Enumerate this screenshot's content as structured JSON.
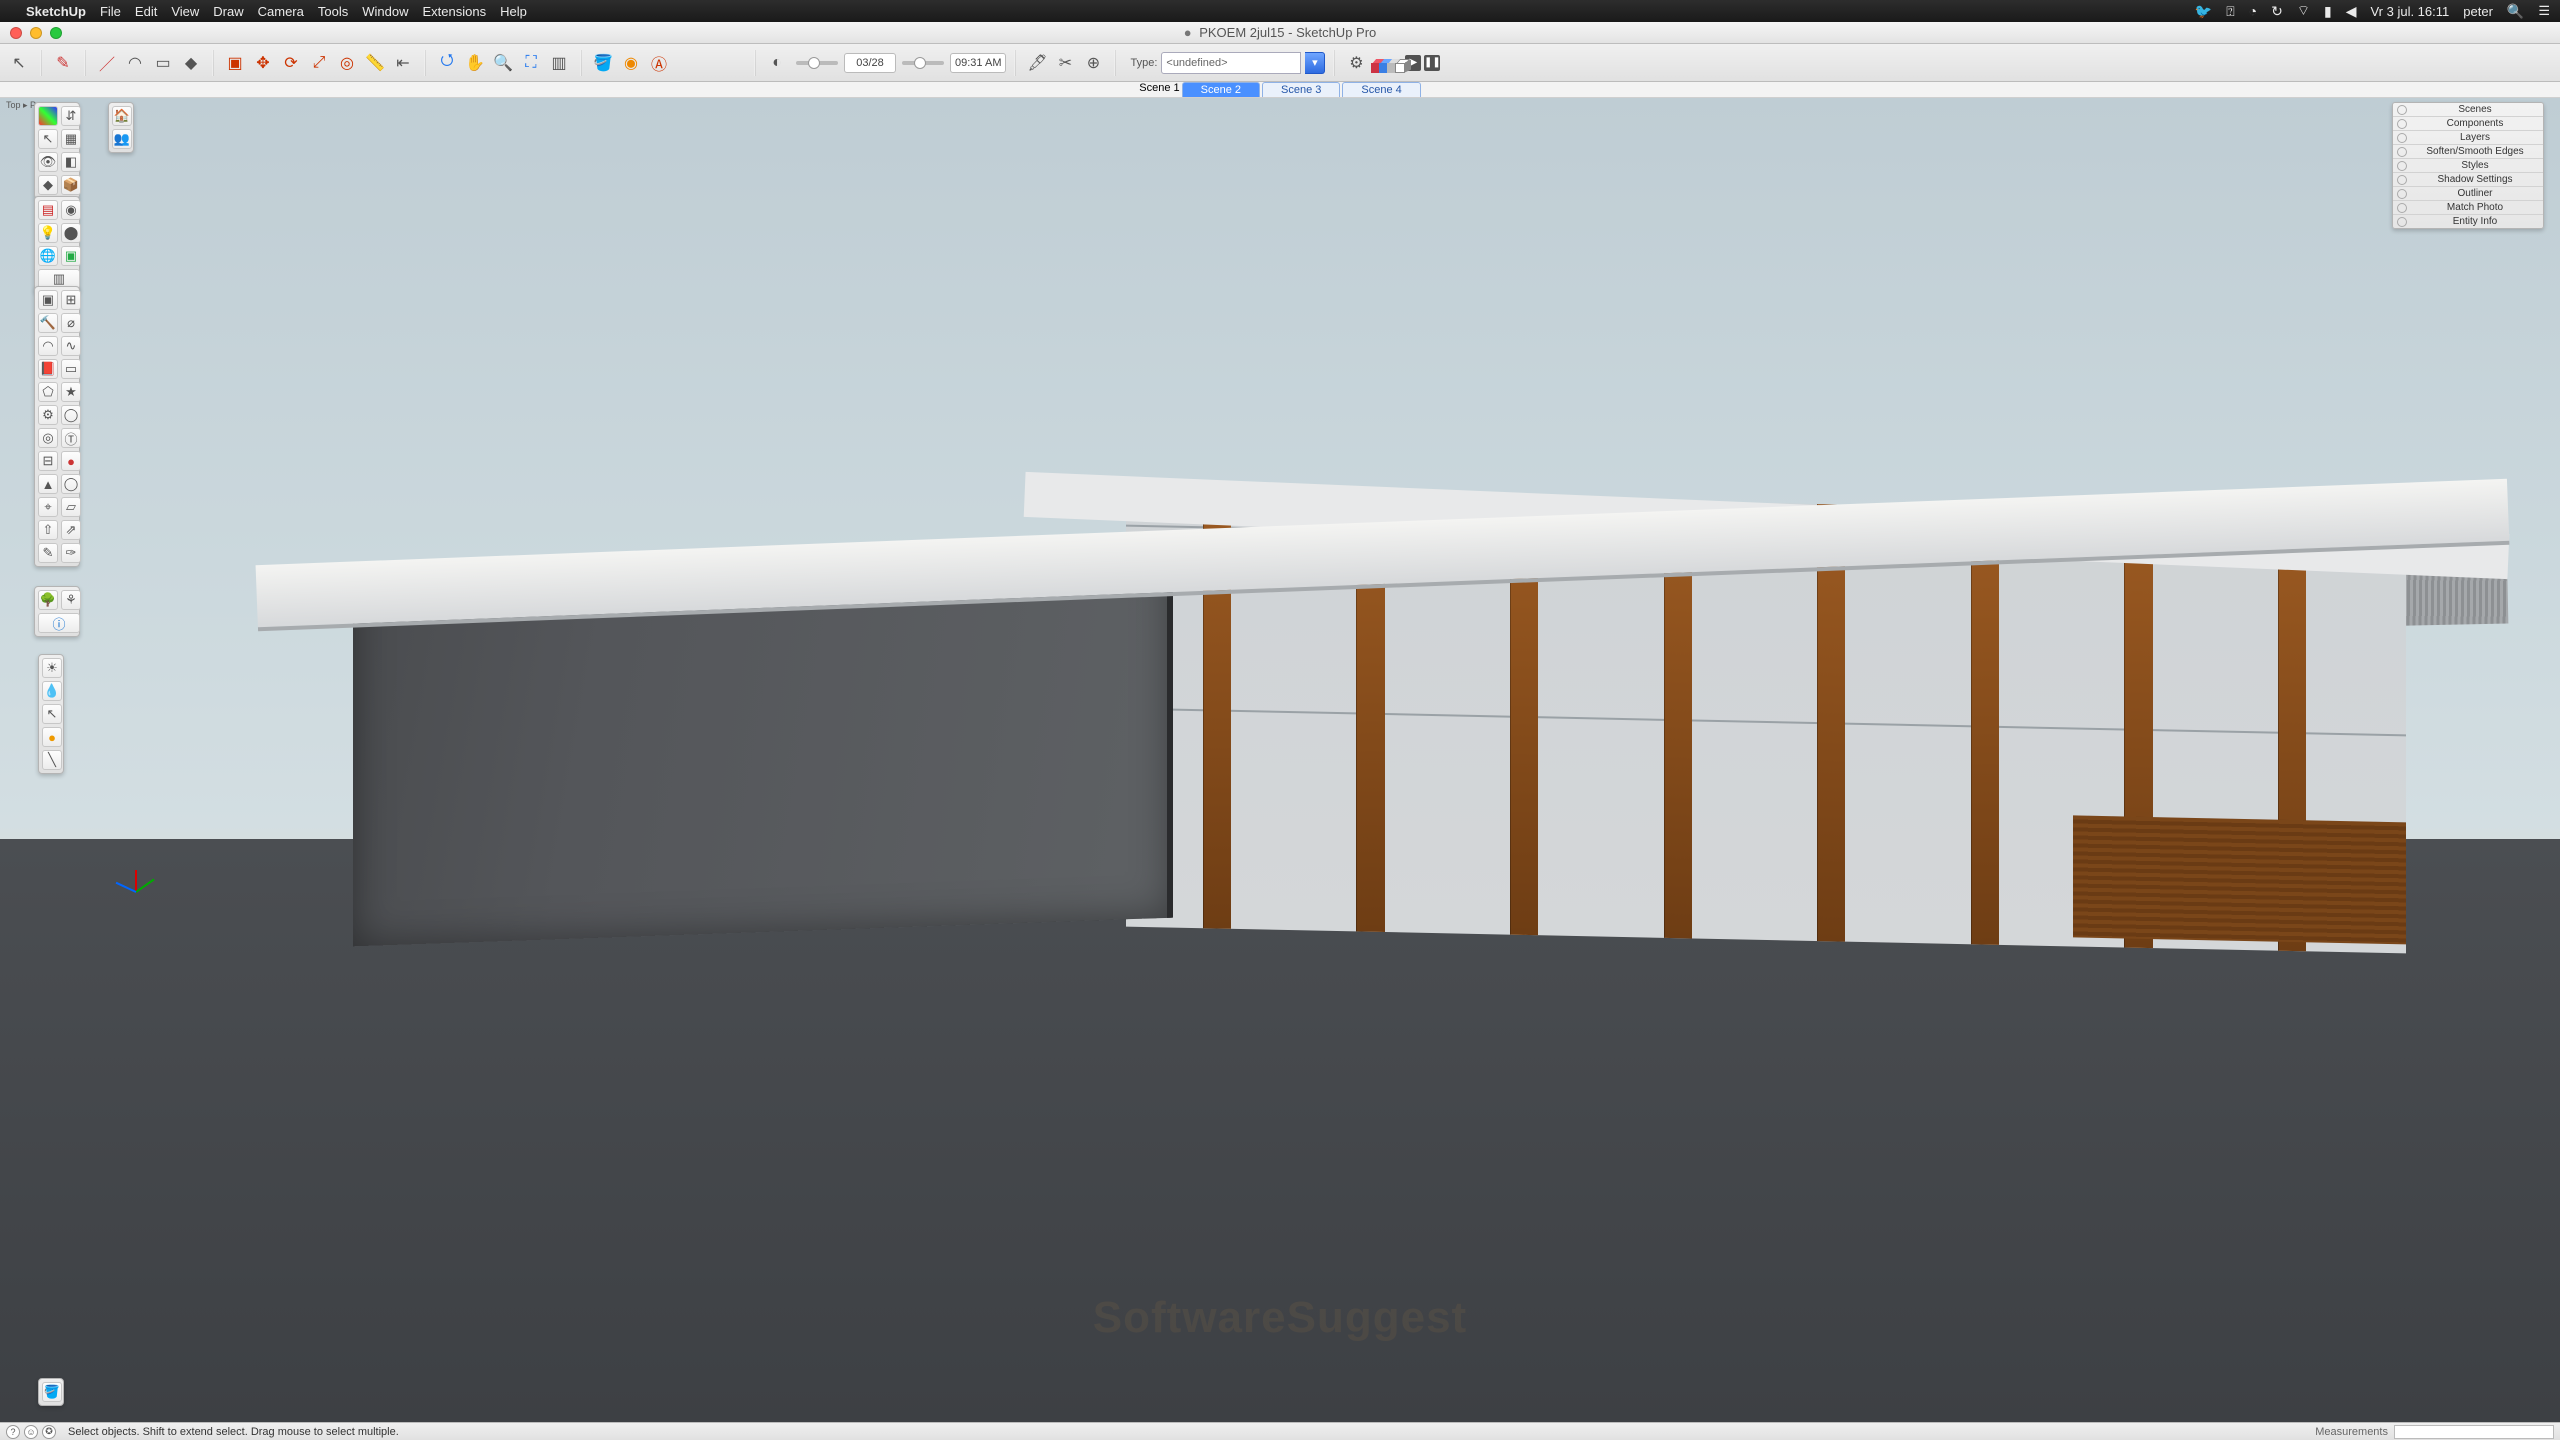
{
  "menubar": {
    "app_name": "SketchUp",
    "items": [
      "File",
      "Edit",
      "View",
      "Draw",
      "Camera",
      "Tools",
      "Window",
      "Extensions",
      "Help"
    ],
    "clock": "Vr 3 jul. 16:11",
    "user": "peter",
    "right_icons": [
      "twitter-icon",
      "help-icon",
      "drive-icon",
      "timemachine-icon",
      "wifi-icon",
      "volume-icon",
      "battery-icon",
      "spotlight-icon",
      "menu-icon"
    ]
  },
  "title": {
    "document": "PKOEM 2jul15",
    "suffix": "SketchUp Pro"
  },
  "toolbar": {
    "type_label": "Type:",
    "type_value": "<undefined>",
    "date_readout": "03/28",
    "time_readout": "09:31 AM"
  },
  "scenes": {
    "tabs": [
      "Scene 1",
      "Scene 2",
      "Scene 3",
      "Scene 4"
    ],
    "active": 0
  },
  "view_label": "Top ▸\nPerspe",
  "tray": {
    "panels": [
      "Scenes",
      "Components",
      "Layers",
      "Soften/Smooth Edges",
      "Styles",
      "Shadow Settings",
      "Outliner",
      "Match Photo",
      "Entity Info"
    ]
  },
  "status": {
    "hint": "Select objects. Shift to extend select. Drag mouse to select multiple.",
    "measurements_label": "Measurements"
  },
  "watermark": "SoftwareSuggest"
}
